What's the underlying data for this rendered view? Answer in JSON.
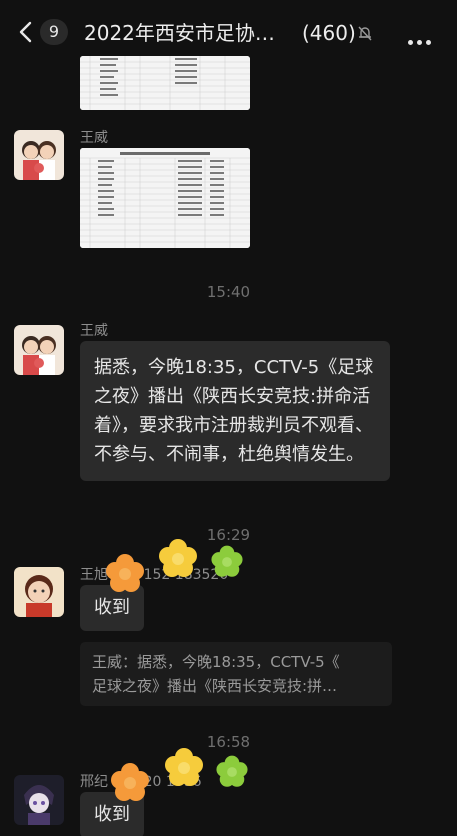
{
  "header": {
    "back_count": "9",
    "title": "2022年西安市足协…",
    "member_count": "(460)"
  },
  "messages": {
    "m1_name": "王威",
    "time1": "15:40",
    "m2_name": "王威",
    "m2_text": "据悉，今晚18:35，CCTV-5《足球之夜》播出《陕西长安竞技:拼命活着》，要求我市注册裁判员不观看、不参与、不闹事，杜绝舆情发生。",
    "time2": "16:29",
    "m3_name": "王旭 173 152 183520",
    "m3_text": "收到",
    "quote_line1": "王威：据悉，今晚18:35，CCTV-5《",
    "quote_line2": "足球之夜》播出《陕西长安竞技:拼…",
    "time3": "16:58",
    "m4_name": "邢纪 132 20 1096",
    "m4_text": "收到"
  },
  "colors": {
    "background": "#111111",
    "bubble": "#2b2b2b",
    "secondary_text": "#8e8e8e",
    "flower_orange": "#f59a3a",
    "flower_yellow": "#f6cc3c",
    "flower_green": "#8ccc3c"
  },
  "icons": [
    "chevron-left-icon",
    "mute-bell-icon",
    "more-icon",
    "flower-sticker"
  ]
}
